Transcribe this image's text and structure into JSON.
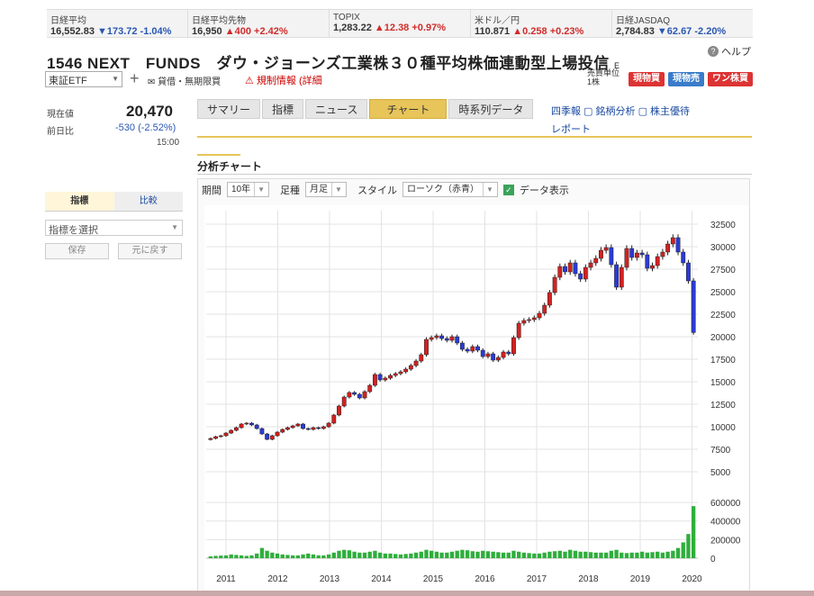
{
  "tickers": [
    {
      "name": "日経平均",
      "value": "16,552.83",
      "change": "▼173.72 -1.04%",
      "dir": "down"
    },
    {
      "name": "日経平均先物",
      "value": "16,950",
      "change": "▲400 +2.42%",
      "dir": "up"
    },
    {
      "name": "TOPIX",
      "value": "1,283.22",
      "change": "▲12.38 +0.97%",
      "dir": "up"
    },
    {
      "name": "米ドル／円",
      "value": "110.871",
      "change": "▲0.258 +0.23%",
      "dir": "up"
    },
    {
      "name": "日経JASDAQ",
      "value": "2,784.83",
      "change": "▼62.67 -2.20%",
      "dir": "down"
    }
  ],
  "help_label": "ヘルプ",
  "stock_title": "1546 NEXT　FUNDS　ダウ・ジョーンズ工業株３０種平均株価連動型上場投信",
  "title_suffix": "E",
  "market": "東証ETF",
  "lending_label": "貸借・無期限買",
  "restriction_label": "規制情報",
  "restriction_detail": "(詳細",
  "unit_label": "売買単位",
  "unit_value": "1株",
  "buttons": {
    "spot_buy": "現物買",
    "spot_sell": "現物売",
    "one_stock": "ワン株買"
  },
  "price": {
    "label": "現在値",
    "value": "20,470",
    "change_label": "前日比",
    "change": "-530",
    "change_pct": "(-2.52%)",
    "time": "15:00"
  },
  "tabs": [
    "サマリー",
    "指標",
    "ニュース",
    "チャート",
    "時系列データ"
  ],
  "active_tab": "チャート",
  "extra_links": [
    "四季報",
    "銘柄分析",
    "株主優待",
    "レポート"
  ],
  "section_title": "分析チャート",
  "side_tabs": [
    "指標",
    "比較"
  ],
  "side_select": "指標を選択",
  "side_buttons": {
    "save": "保存",
    "reset": "元に戻す"
  },
  "toolbar": {
    "period_label": "期間",
    "period": "10年",
    "basis_label": "足種",
    "basis": "月足",
    "style_label": "スタイル",
    "style": "ローソク（赤青）",
    "data_label": "データ表示"
  },
  "colors": {
    "up_candle": "#d62020",
    "down_candle": "#2b3bd6",
    "volume": "#2fae3c",
    "accent": "#e7c55a"
  },
  "chart_data": {
    "type": "candlestick",
    "x_labels": [
      "2011",
      "2012",
      "2013",
      "2014",
      "2015",
      "2016",
      "2017",
      "2018",
      "2019",
      "2020"
    ],
    "y_ticks": [
      5000,
      7500,
      10000,
      12500,
      15000,
      17500,
      20000,
      22500,
      25000,
      27500,
      30000,
      32500
    ],
    "volume_ticks": [
      0,
      200000,
      400000,
      600000
    ],
    "ylim": [
      3000,
      34000
    ],
    "close": [
      8700,
      8900,
      9000,
      9300,
      9600,
      9900,
      10300,
      10400,
      10200,
      9800,
      9200,
      8600,
      9000,
      9400,
      9700,
      9900,
      10100,
      10300,
      9800,
      9700,
      9900,
      9800,
      10000,
      10400,
      11300,
      12300,
      13300,
      13800,
      13600,
      13200,
      13900,
      14600,
      15800,
      15200,
      15400,
      15700,
      15900,
      16100,
      16400,
      16800,
      17300,
      18000,
      19700,
      19900,
      20100,
      19800,
      19600,
      20000,
      19300,
      18600,
      18400,
      18900,
      18500,
      17800,
      18100,
      17400,
      17700,
      18300,
      18100,
      19900,
      21500,
      21800,
      21900,
      22100,
      22600,
      23500,
      24900,
      26600,
      27800,
      27200,
      28200,
      27000,
      26400,
      27700,
      28200,
      28700,
      29600,
      29900,
      28000,
      25500,
      27700,
      29800,
      28800,
      29300,
      29100,
      27600,
      27900,
      28900,
      29400,
      30300,
      31000,
      29400,
      28200,
      26200,
      20470
    ],
    "volume": [
      20000,
      25000,
      28000,
      30000,
      40000,
      35000,
      30000,
      25000,
      30000,
      50000,
      110000,
      80000,
      60000,
      50000,
      40000,
      35000,
      30000,
      30000,
      40000,
      50000,
      40000,
      30000,
      30000,
      40000,
      60000,
      80000,
      90000,
      85000,
      70000,
      60000,
      60000,
      70000,
      80000,
      60000,
      50000,
      50000,
      45000,
      40000,
      45000,
      50000,
      60000,
      70000,
      90000,
      80000,
      70000,
      60000,
      60000,
      70000,
      80000,
      90000,
      85000,
      75000,
      70000,
      80000,
      75000,
      70000,
      65000,
      60000,
      60000,
      80000,
      70000,
      60000,
      55000,
      50000,
      50000,
      60000,
      70000,
      75000,
      80000,
      70000,
      90000,
      80000,
      70000,
      70000,
      65000,
      60000,
      60000,
      60000,
      80000,
      90000,
      60000,
      55000,
      60000,
      60000,
      70000,
      60000,
      65000,
      70000,
      60000,
      70000,
      80000,
      110000,
      170000,
      260000,
      560000
    ]
  }
}
